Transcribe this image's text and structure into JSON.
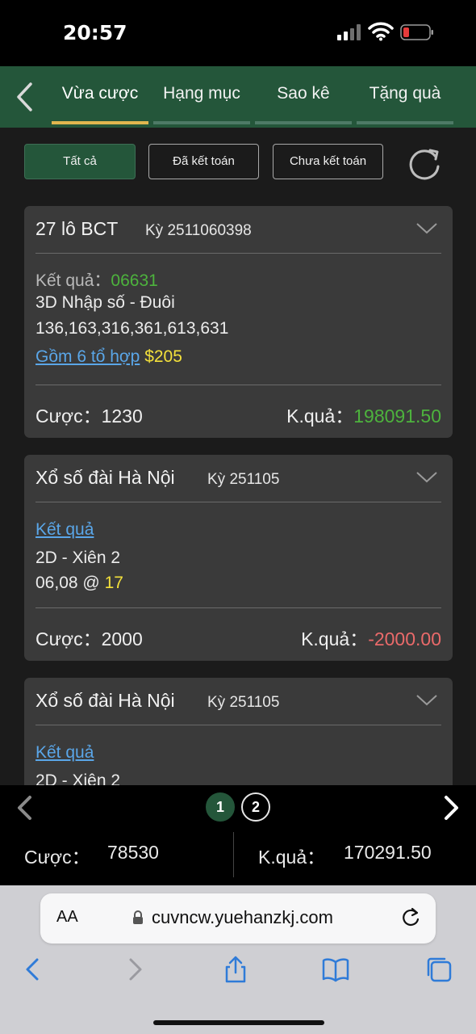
{
  "status_bar": {
    "time": "20:57"
  },
  "nav": {
    "tabs": [
      {
        "label": "Vừa cược",
        "active": true
      },
      {
        "label": "Hạng mục",
        "active": false
      },
      {
        "label": "Sao kê",
        "active": false
      },
      {
        "label": "Tặng quà",
        "active": false
      }
    ]
  },
  "filters": [
    {
      "label": "Tất cả",
      "active": true
    },
    {
      "label": "Đã kết toán",
      "active": false
    },
    {
      "label": "Chưa kết toán",
      "active": false
    }
  ],
  "bets": [
    {
      "game": "27 lô BCT",
      "period": "Kỳ 2511060398",
      "result_label": "Kết quả：",
      "result_value": "06631",
      "play_type": "3D Nhập số - Đuôi",
      "numbers": "136,163,316,361,613,631",
      "combo_link": "Gồm 6 tổ hợp",
      "combo_amount": "$205",
      "bet_label": "Cược：",
      "bet_amount": "1230",
      "outcome_label": "K.quả：",
      "outcome_value": "198091.50",
      "outcome_color": "#4db33d"
    },
    {
      "game": "Xổ số đài Hà Nội",
      "period": "Kỳ 251105",
      "result_link": "Kết quả",
      "play_type": "2D - Xiên 2",
      "numbers": "06,08 @",
      "odds": "17",
      "bet_label": "Cược：",
      "bet_amount": "2000",
      "outcome_label": "K.quả：",
      "outcome_value": "-2000.00",
      "outcome_color": "#ea6a6a"
    },
    {
      "game": "Xổ số đài Hà Nội",
      "period": "Kỳ 251105",
      "result_link": "Kết quả",
      "play_type": "2D - Xiên 2"
    }
  ],
  "pager": {
    "pages": [
      "1",
      "2"
    ],
    "current": "1"
  },
  "totals": {
    "bet_label": "Cược：",
    "bet_value": "78530",
    "outcome_label": "K.quả：",
    "outcome_value": "170291.50"
  },
  "browser": {
    "aa_label": "AA",
    "url": "cuvncw.yuehanzkj.com"
  },
  "colors": {
    "accent_green": "#24563a",
    "active_tab_underline": "#e0b64f",
    "win": "#4db33d",
    "loss": "#ea6a6a",
    "highlight": "#f3e03b",
    "link": "#5aa6e8"
  }
}
